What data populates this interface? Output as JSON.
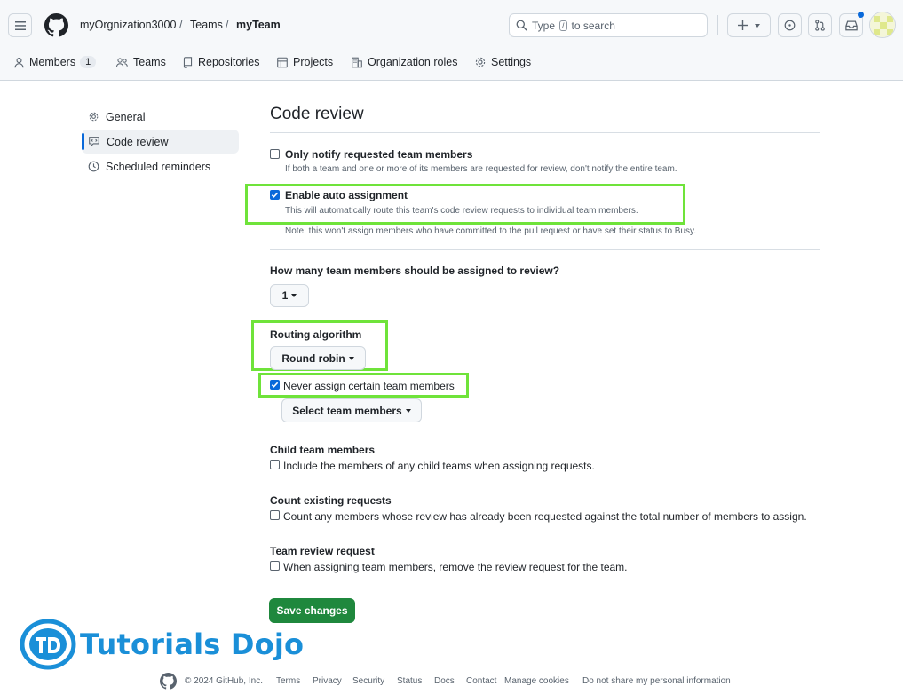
{
  "header": {
    "org": "myOrgnization3000",
    "sep1": "/",
    "teams": "Teams",
    "sep2": "/",
    "team": "myTeam",
    "search_prefix": "Type",
    "search_key": "/",
    "search_suffix": "to search"
  },
  "tabs": {
    "members": "Members",
    "members_count": "1",
    "teams": "Teams",
    "repositories": "Repositories",
    "projects": "Projects",
    "org_roles": "Organization roles",
    "settings": "Settings"
  },
  "sidebar": {
    "general": "General",
    "code_review": "Code review",
    "reminders": "Scheduled reminders"
  },
  "main": {
    "title": "Code review",
    "only_notify_label": "Only notify requested team members",
    "only_notify_note": "If both a team and one or more of its members are requested for review, don't notify the entire team.",
    "auto_assign_label": "Enable auto assignment",
    "auto_assign_note": "This will automatically route this team's code review requests to individual team members.",
    "auto_assign_note2": "Note: this won't assign members who have committed to the pull request or have set their status to Busy.",
    "how_many_label": "How many team members should be assigned to review?",
    "how_many_value": "1",
    "routing_label": "Routing algorithm",
    "routing_value": "Round robin",
    "never_assign_label": "Never assign certain team members",
    "select_members": "Select team members",
    "child_label": "Child team members",
    "child_text": "Include the members of any child teams when assigning requests.",
    "count_label": "Count existing requests",
    "count_text": "Count any members whose review has already been requested against the total number of members to assign.",
    "review_label": "Team review request",
    "review_text": "When assigning team members, remove the review request for the team.",
    "save": "Save changes"
  },
  "checkboxes": {
    "only_notify": false,
    "auto_assign": true,
    "never_assign": true,
    "child": false,
    "count": false,
    "review": false
  },
  "watermark": "Tutorials Dojo",
  "footer": {
    "copyright": "© 2024 GitHub, Inc.",
    "terms": "Terms",
    "privacy": "Privacy",
    "security": "Security",
    "status": "Status",
    "docs": "Docs",
    "contact": "Contact",
    "cookies": "Manage cookies",
    "personal": "Do not share my personal information"
  },
  "colors": {
    "accent": "#0969da",
    "save": "#1f883d",
    "highlight": "#6fe33a",
    "watermark": "#1a8fd8"
  }
}
